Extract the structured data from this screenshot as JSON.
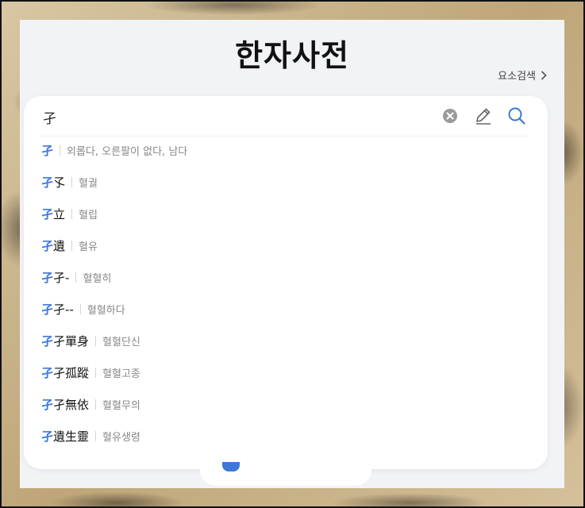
{
  "header": {
    "title": "한자사전",
    "element_search_label": "요소검색"
  },
  "search": {
    "value": "孑",
    "placeholder": ""
  },
  "results": [
    {
      "highlight": "孑",
      "rest": "",
      "meaning": "외롭다, 오른팔이 없다, 남다"
    },
    {
      "highlight": "孑",
      "rest": "孓",
      "meaning": "혈궐"
    },
    {
      "highlight": "孑",
      "rest": "立",
      "meaning": "혈립"
    },
    {
      "highlight": "孑",
      "rest": "遺",
      "meaning": "혈유"
    },
    {
      "highlight": "孑",
      "rest": "孑-",
      "meaning": "혈혈히"
    },
    {
      "highlight": "孑",
      "rest": "孑--",
      "meaning": "혈혈하다"
    },
    {
      "highlight": "孑",
      "rest": "孑單身",
      "meaning": "혈혈단신"
    },
    {
      "highlight": "孑",
      "rest": "孑孤蹤",
      "meaning": "혈혈고종"
    },
    {
      "highlight": "孑",
      "rest": "孑無依",
      "meaning": "혈혈무의"
    },
    {
      "highlight": "孑",
      "rest": "遺生靈",
      "meaning": "혈유생령"
    }
  ],
  "icons": {
    "clear": "clear-icon",
    "handwriting": "pen-icon",
    "search": "search-icon",
    "chevron": "chevron-right-icon"
  },
  "colors": {
    "accent": "#3d78d8",
    "panel": "#f2f3f6"
  }
}
